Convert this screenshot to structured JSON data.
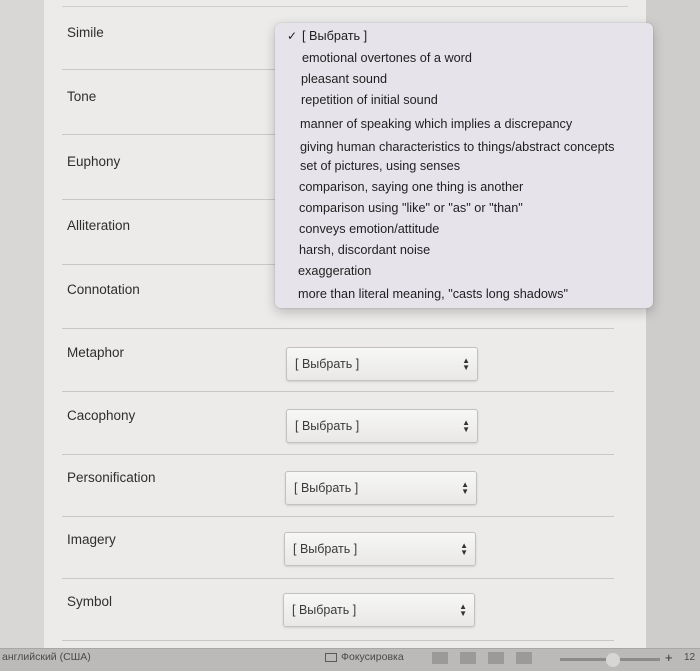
{
  "terms": [
    {
      "name": "Simile",
      "selected": "[ Выбрать ]"
    },
    {
      "name": "Tone",
      "selected": "[ Выбрать ]"
    },
    {
      "name": "Euphony",
      "selected": "[ Выбрать ]"
    },
    {
      "name": "Alliteration",
      "selected": "[ Выбрать ]"
    },
    {
      "name": "Connotation",
      "selected": "[ Выбрать ]"
    },
    {
      "name": "Metaphor",
      "selected": "[ Выбрать ]"
    },
    {
      "name": "Cacophony",
      "selected": "[ Выбрать ]"
    },
    {
      "name": "Personification",
      "selected": "[ Выбрать ]"
    },
    {
      "name": "Imagery",
      "selected": "[ Выбрать ]"
    },
    {
      "name": "Symbol",
      "selected": "[ Выбрать ]"
    }
  ],
  "dropdown": {
    "checkmark": "✓",
    "options": [
      "[ Выбрать ]",
      "emotional overtones of a word",
      "pleasant sound",
      "repetition of initial sound",
      "manner of speaking which implies a discrepancy",
      "giving human characteristics to things/abstract concepts",
      "set of pictures, using senses",
      "comparison, saying one thing is another",
      "comparison using \"like\" or \"as\" or \"than\"",
      "conveys emotion/attitude",
      "harsh, discordant noise",
      "exaggeration",
      "more than literal meaning, \"casts long shadows\""
    ]
  },
  "status_bar": {
    "language": "английский (США)",
    "focus_label": "Фокусировка",
    "zoom_plus": "+",
    "zoom_value": "12"
  }
}
